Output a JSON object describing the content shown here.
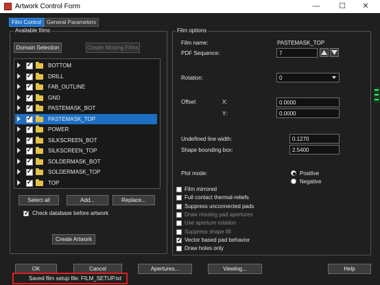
{
  "window": {
    "title": "Artwork Control Form",
    "minimize": "—",
    "maximize": "☐",
    "close": "✕"
  },
  "tabs": [
    "Film Control",
    "General Parameters"
  ],
  "available_films": {
    "group_label": "Available films",
    "domain_button": "Domain Selection",
    "create_missing_button": "Create Missing Films",
    "films": [
      {
        "name": "BOTTOM",
        "checked": true,
        "selected": false
      },
      {
        "name": "DRILL",
        "checked": true,
        "selected": false
      },
      {
        "name": "FAB_OUTLINE",
        "checked": true,
        "selected": false
      },
      {
        "name": "GND",
        "checked": true,
        "selected": false
      },
      {
        "name": "PASTEMASK_BOT",
        "checked": true,
        "selected": false
      },
      {
        "name": "PASTEMASK_TOP",
        "checked": true,
        "selected": true
      },
      {
        "name": "POWER",
        "checked": true,
        "selected": false
      },
      {
        "name": "SILKSCREEN_BOT",
        "checked": true,
        "selected": false
      },
      {
        "name": "SILKSCREEN_TOP",
        "checked": true,
        "selected": false
      },
      {
        "name": "SOLDERMASK_BOT",
        "checked": true,
        "selected": false
      },
      {
        "name": "SOLDERMASK_TOP",
        "checked": true,
        "selected": false
      },
      {
        "name": "TOP",
        "checked": true,
        "selected": false
      }
    ],
    "select_all": "Select all",
    "add": "Add...",
    "replace": "Replace...",
    "check_db_label": "Check database before artwork",
    "create_artwork": "Create Artwork"
  },
  "film_options": {
    "group_label": "Film options",
    "film_name_label": "Film name:",
    "film_name_value": "PASTEMASK_TOP",
    "pdf_seq_label": "PDF Sequence:",
    "pdf_seq_value": "7",
    "rotation_label": "Rotation:",
    "rotation_value": "0",
    "offset_label": "Offset",
    "x_label": "X:",
    "x_value": "0.0000",
    "y_label": "Y:",
    "y_value": "0.0000",
    "undefined_line_label": "Undefined line width:",
    "undefined_line_value": "0.1270",
    "shape_bbox_label": "Shape bounding box:",
    "shape_bbox_value": "2.5400",
    "plot_mode_label": "Plot mode:",
    "plot_positive": "Positive",
    "plot_negative": "Negative",
    "options": [
      {
        "label": "Film mirrored",
        "checked": false,
        "disabled": false
      },
      {
        "label": "Full contact thermal-reliefs",
        "checked": false,
        "disabled": false
      },
      {
        "label": "Suppress unconnected pads",
        "checked": false,
        "disabled": false
      },
      {
        "label": "Draw missing pad apertures",
        "checked": false,
        "disabled": true
      },
      {
        "label": "Use aperture rotation",
        "checked": false,
        "disabled": true
      },
      {
        "label": "Suppress shape fill",
        "checked": false,
        "disabled": true
      },
      {
        "label": "Vector based pad behavior",
        "checked": true,
        "disabled": false
      },
      {
        "label": "Draw holes only",
        "checked": false,
        "disabled": false
      }
    ]
  },
  "bottom_buttons": {
    "ok": "OK",
    "cancel": "Cancel",
    "apertures": "Apertures...",
    "viewlog": "Viewlog...",
    "help": "Help"
  },
  "status": "Saved film setup file: FILM_SETUP.txt"
}
